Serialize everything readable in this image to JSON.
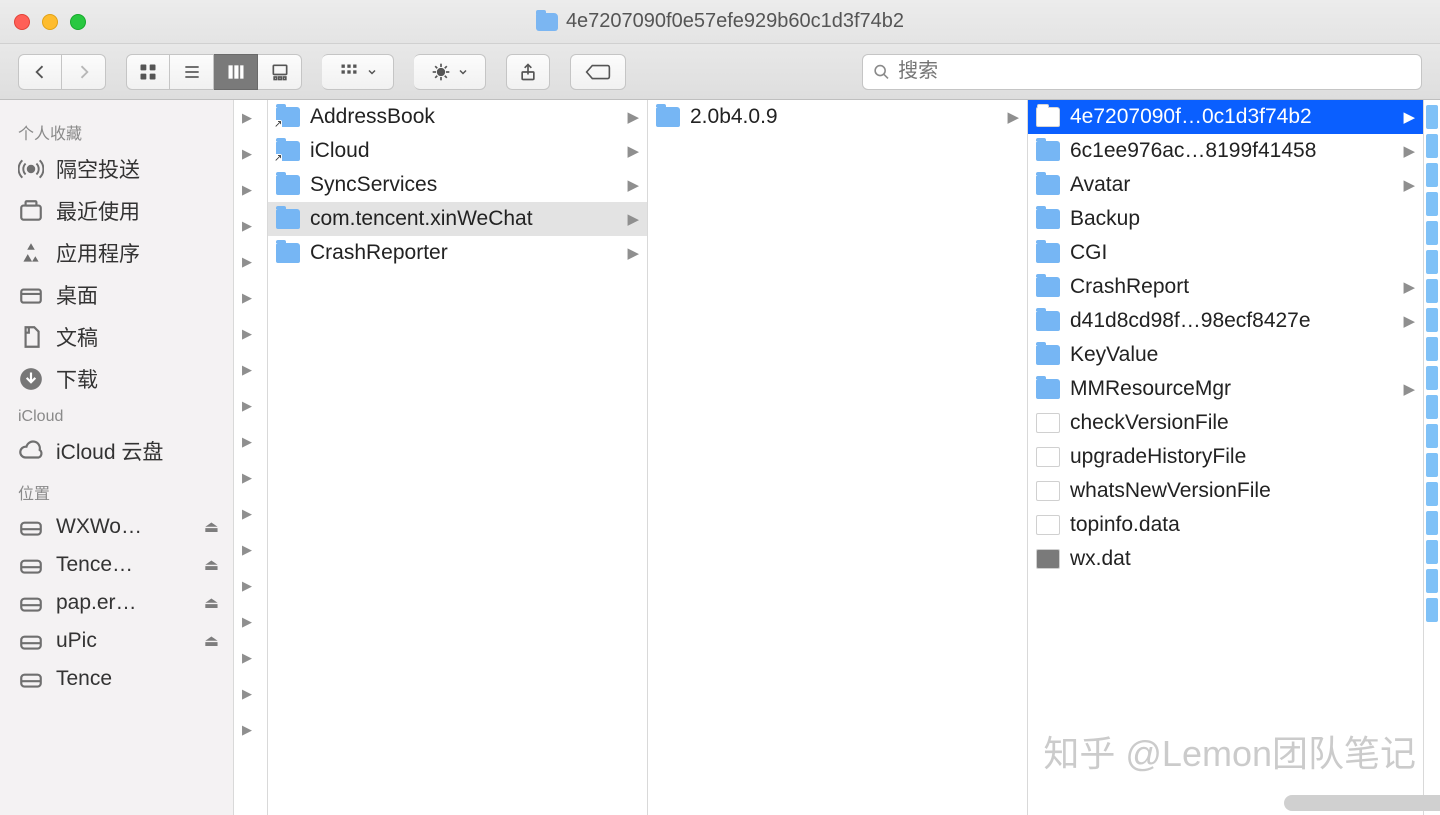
{
  "window": {
    "title": "4e7207090f0e57efe929b60c1d3f74b2"
  },
  "search": {
    "placeholder": "搜索"
  },
  "sidebar": {
    "sections": [
      {
        "title": "个人收藏",
        "items": [
          {
            "icon": "airdrop",
            "label": "隔空投送"
          },
          {
            "icon": "recent",
            "label": "最近使用"
          },
          {
            "icon": "apps",
            "label": "应用程序"
          },
          {
            "icon": "desktop",
            "label": "桌面"
          },
          {
            "icon": "docs",
            "label": "文稿"
          },
          {
            "icon": "download",
            "label": "下载"
          }
        ]
      },
      {
        "title": "iCloud",
        "items": [
          {
            "icon": "cloud",
            "label": "iCloud 云盘"
          }
        ]
      },
      {
        "title": "位置",
        "items": [
          {
            "icon": "disk",
            "label": "WXWo…",
            "eject": true
          },
          {
            "icon": "disk",
            "label": "Tence…",
            "eject": true
          },
          {
            "icon": "disk",
            "label": "pap.er…",
            "eject": true
          },
          {
            "icon": "disk",
            "label": "uPic",
            "eject": true
          },
          {
            "icon": "disk",
            "label": "Tence",
            "eject": false
          }
        ]
      }
    ]
  },
  "col0_arrows": 18,
  "col1": [
    {
      "name": "AddressBook",
      "type": "folder-alias",
      "nav": true
    },
    {
      "name": "iCloud",
      "type": "folder-alias",
      "nav": true
    },
    {
      "name": "SyncServices",
      "type": "folder",
      "nav": true
    },
    {
      "name": "com.tencent.xinWeChat",
      "type": "folder",
      "nav": true,
      "sel": "path"
    },
    {
      "name": "CrashReporter",
      "type": "folder",
      "nav": true
    }
  ],
  "col2": [
    {
      "name": "2.0b4.0.9",
      "type": "folder",
      "nav": true,
      "sel": "path-implied"
    }
  ],
  "col3": [
    {
      "name": "4e7207090f…0c1d3f74b2",
      "type": "folder",
      "nav": true,
      "sel": "active"
    },
    {
      "name": "6c1ee976ac…8199f41458",
      "type": "folder",
      "nav": true
    },
    {
      "name": "Avatar",
      "type": "folder",
      "nav": true
    },
    {
      "name": "Backup",
      "type": "folder"
    },
    {
      "name": "CGI",
      "type": "folder"
    },
    {
      "name": "CrashReport",
      "type": "folder",
      "nav": true
    },
    {
      "name": "d41d8cd98f…98ecf8427e",
      "type": "folder",
      "nav": true
    },
    {
      "name": "KeyValue",
      "type": "folder"
    },
    {
      "name": "MMResourceMgr",
      "type": "folder",
      "nav": true
    },
    {
      "name": "checkVersionFile",
      "type": "file"
    },
    {
      "name": "upgradeHistoryFile",
      "type": "file"
    },
    {
      "name": "whatsNewVersionFile",
      "type": "file"
    },
    {
      "name": "topinfo.data",
      "type": "file"
    },
    {
      "name": "wx.dat",
      "type": "file-dark"
    }
  ],
  "col4_squares": 18,
  "watermark": "知乎 @Lemon团队笔记"
}
